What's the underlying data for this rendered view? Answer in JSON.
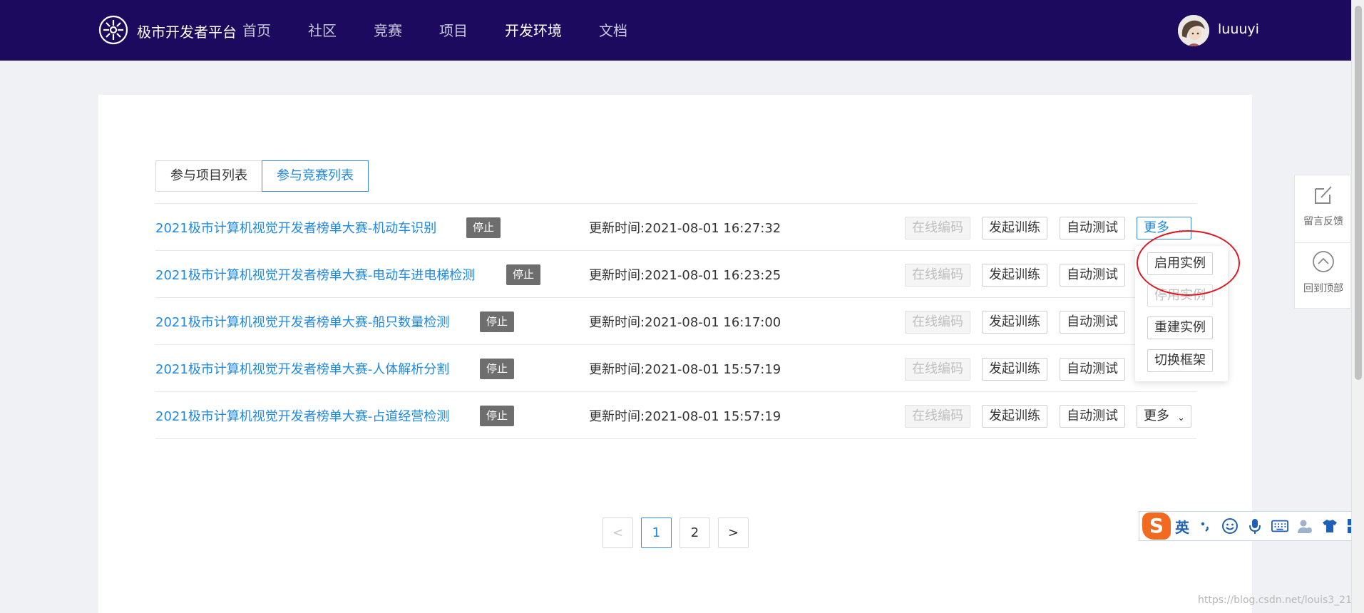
{
  "header": {
    "brand": "极市开发者平台",
    "nav": [
      {
        "label": "首页",
        "active": false
      },
      {
        "label": "社区",
        "active": false
      },
      {
        "label": "竞赛",
        "active": false
      },
      {
        "label": "项目",
        "active": false
      },
      {
        "label": "开发环境",
        "active": true
      },
      {
        "label": "文档",
        "active": false
      }
    ],
    "username": "luuuyi"
  },
  "tabs": [
    {
      "label": "参与项目列表",
      "active": false
    },
    {
      "label": "参与竞赛列表",
      "active": true
    }
  ],
  "rows": [
    {
      "title": "2021极市计算机视觉开发者榜单大赛-机动车识别",
      "status": "停止",
      "updated": "更新时间:2021-08-01 16:27:32"
    },
    {
      "title": "2021极市计算机视觉开发者榜单大赛-电动车进电梯检测",
      "status": "停止",
      "updated": "更新时间:2021-08-01 16:23:25"
    },
    {
      "title": "2021极市计算机视觉开发者榜单大赛-船只数量检测",
      "status": "停止",
      "updated": "更新时间:2021-08-01 16:17:00"
    },
    {
      "title": "2021极市计算机视觉开发者榜单大赛-人体解析分割",
      "status": "停止",
      "updated": "更新时间:2021-08-01 15:57:19"
    },
    {
      "title": "2021极市计算机视觉开发者榜单大赛-占道经营检测",
      "status": "停止",
      "updated": "更新时间:2021-08-01 15:57:19"
    }
  ],
  "actions": {
    "online_code": "在线编码",
    "start_train": "发起训练",
    "auto_test": "自动测试",
    "more": "更多"
  },
  "dropdown": {
    "items": [
      {
        "label": "启用实例",
        "disabled": false
      },
      {
        "label": "停用实例",
        "disabled": true
      },
      {
        "label": "重建实例",
        "disabled": false
      },
      {
        "label": "切换框架",
        "disabled": false
      }
    ]
  },
  "pagination": {
    "prev": "<",
    "pages": [
      "1",
      "2"
    ],
    "current": "1",
    "next": ">"
  },
  "side_float": {
    "feedback": "留言反馈",
    "back_to_top": "回到顶部"
  },
  "ime": {
    "logo": "S",
    "lang": "英",
    "icons": [
      "punctuation-icon",
      "emoji-icon",
      "microphone-icon",
      "keyboard-icon",
      "user-icon",
      "skin-icon",
      "toolbox-icon"
    ]
  },
  "watermark": "https://blog.csdn.net/louis3_21",
  "colors": {
    "header_bg": "#1c0a5e",
    "link": "#1e88e5",
    "status_bg": "#6e6e6e",
    "highlight": "#e0161e",
    "ime_orange": "#f26a20"
  }
}
